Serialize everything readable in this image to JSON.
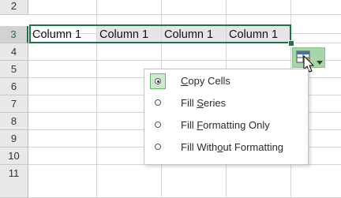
{
  "rows": [
    {
      "num": "2",
      "cells": [
        "",
        "",
        "",
        ""
      ]
    },
    {
      "num": "3",
      "cells": [
        "Column 1",
        "Column 1",
        "Column 1",
        "Column 1"
      ]
    },
    {
      "num": "4",
      "cells": [
        "",
        "",
        "",
        ""
      ]
    },
    {
      "num": "5",
      "cells": [
        "",
        "",
        "",
        ""
      ]
    },
    {
      "num": "6",
      "cells": [
        "",
        "",
        "",
        ""
      ]
    },
    {
      "num": "7",
      "cells": [
        "",
        "",
        "",
        ""
      ]
    },
    {
      "num": "8",
      "cells": [
        "",
        "",
        "",
        ""
      ]
    },
    {
      "num": "9",
      "cells": [
        "",
        "",
        "",
        ""
      ]
    },
    {
      "num": "10",
      "cells": [
        "",
        "",
        "",
        ""
      ]
    },
    {
      "num": "11",
      "cells": [
        "",
        "",
        "",
        ""
      ]
    }
  ],
  "autofill_menu": {
    "selected_index": 0,
    "items": [
      {
        "pre": "",
        "key": "C",
        "post": "opy Cells"
      },
      {
        "pre": "Fill ",
        "key": "S",
        "post": "eries"
      },
      {
        "pre": "Fill ",
        "key": "F",
        "post": "ormatting Only"
      },
      {
        "pre": "Fill With",
        "key": "o",
        "post": "ut Formatting"
      }
    ]
  },
  "colors": {
    "accent": "#217346",
    "button_bg": "#a5d6a7",
    "selected_item_bg": "#cfe9cf"
  },
  "icons": {
    "autofill_button": "autofill-options-icon",
    "caret": "chevron-down-icon",
    "cursor": "mouse-pointer-icon"
  }
}
